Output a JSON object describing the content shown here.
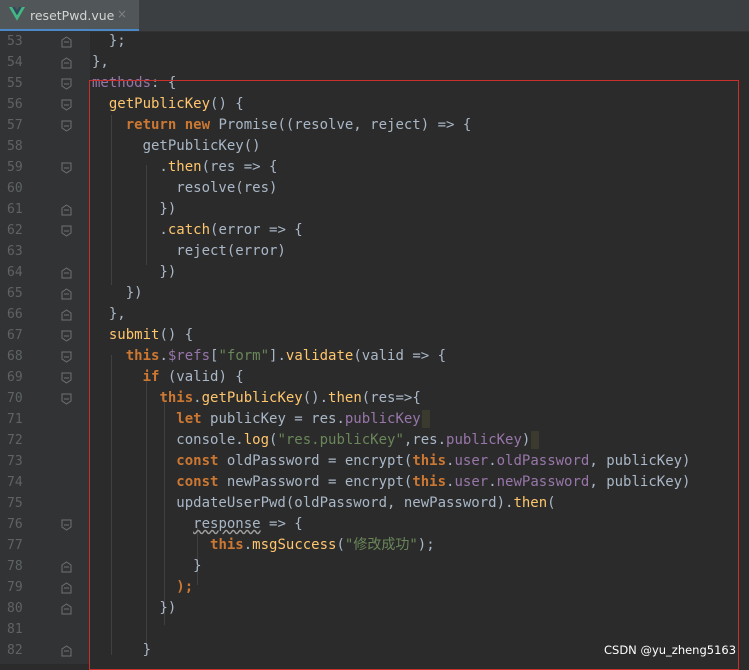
{
  "tab": {
    "filename": "resetPwd.vue",
    "close_glyph": "×",
    "icon": "vue-logo-icon"
  },
  "colors": {
    "background": "#2b2b2b",
    "gutter": "#313335",
    "keyword": "#cc7832",
    "function": "#ffc66d",
    "string": "#6a8759",
    "property": "#9876aa",
    "text": "#a9b7c6",
    "highlight_box": "#c9302c"
  },
  "lines": [
    {
      "n": "53",
      "fold": "end"
    },
    {
      "n": "54",
      "fold": "end"
    },
    {
      "n": "55",
      "fold": "start"
    },
    {
      "n": "56",
      "fold": "start"
    },
    {
      "n": "57",
      "fold": "start"
    },
    {
      "n": "58",
      "fold": ""
    },
    {
      "n": "59",
      "fold": "start"
    },
    {
      "n": "60",
      "fold": ""
    },
    {
      "n": "61",
      "fold": "end"
    },
    {
      "n": "62",
      "fold": "start"
    },
    {
      "n": "63",
      "fold": ""
    },
    {
      "n": "64",
      "fold": "end"
    },
    {
      "n": "65",
      "fold": "end"
    },
    {
      "n": "66",
      "fold": "end"
    },
    {
      "n": "67",
      "fold": "start"
    },
    {
      "n": "68",
      "fold": "start"
    },
    {
      "n": "69",
      "fold": "start"
    },
    {
      "n": "70",
      "fold": "start"
    },
    {
      "n": "71",
      "fold": ""
    },
    {
      "n": "72",
      "fold": ""
    },
    {
      "n": "73",
      "fold": ""
    },
    {
      "n": "74",
      "fold": ""
    },
    {
      "n": "75",
      "fold": ""
    },
    {
      "n": "76",
      "fold": "start"
    },
    {
      "n": "77",
      "fold": ""
    },
    {
      "n": "78",
      "fold": "end"
    },
    {
      "n": "79",
      "fold": "end"
    },
    {
      "n": "80",
      "fold": "end"
    },
    {
      "n": "81",
      "fold": ""
    },
    {
      "n": "82",
      "fold": "end"
    }
  ],
  "code": {
    "l53": {
      "a": "  };"
    },
    "l54": {
      "a": "},"
    },
    "l55": {
      "a": "methods",
      "b": ": {"
    },
    "l56": {
      "a": "  ",
      "b": "getPublicKey",
      "c": "() {"
    },
    "l57": {
      "a": "    ",
      "b": "return new ",
      "c": "Promise((resolve, reject) => {"
    },
    "l58": {
      "a": "      getPublicKey()"
    },
    "l59": {
      "a": "        .",
      "b": "then",
      "c": "(res => {"
    },
    "l60": {
      "a": "          resolve(res)"
    },
    "l61": {
      "a": "        })"
    },
    "l62": {
      "a": "        .",
      "b": "catch",
      "c": "(error => {"
    },
    "l63": {
      "a": "          reject(error)"
    },
    "l64": {
      "a": "        })"
    },
    "l65": {
      "a": "    })"
    },
    "l66": {
      "a": "  },"
    },
    "l67": {
      "a": "  ",
      "b": "submit",
      "c": "() {"
    },
    "l68": {
      "a": "    ",
      "b": "this",
      "c": ".",
      "d": "$refs",
      "e": "[",
      "f": "\"form\"",
      "g": "].",
      "h": "validate",
      "i": "(valid => {"
    },
    "l69": {
      "a": "      ",
      "b": "if ",
      "c": "(valid) {"
    },
    "l70": {
      "a": "        ",
      "b": "this",
      "c": ".",
      "d": "getPublicKey",
      "e": "().",
      "f": "then",
      "g": "(res=>{"
    },
    "l71": {
      "a": "          ",
      "b": "let ",
      "c": "publicKey = res.",
      "d": "publicKey"
    },
    "l72": {
      "a": "          console.",
      "b": "log",
      "c": "(",
      "d": "\"res.publicKey\"",
      "e": ",res.",
      "f": "publicKey",
      "g": ")"
    },
    "l73": {
      "a": "          ",
      "b": "const ",
      "c": "oldPassword = encrypt(",
      "d": "this",
      "e": ".",
      "f": "user",
      "g": ".",
      "h": "oldPassword",
      "i": ", publicKey)"
    },
    "l74": {
      "a": "          ",
      "b": "const ",
      "c": "newPassword = encrypt(",
      "d": "this",
      "e": ".",
      "f": "user",
      "g": ".",
      "h": "newPassword",
      "i": ", publicKey)"
    },
    "l75": {
      "a": "          updateUserPwd(oldPassword, newPassword).",
      "b": "then",
      "c": "("
    },
    "l76": {
      "a": "            ",
      "b": "response",
      "c": " => {"
    },
    "l77": {
      "a": "              ",
      "b": "this",
      "c": ".",
      "d": "msgSuccess",
      "e": "(",
      "f": "\"修改成功\"",
      "g": ");"
    },
    "l78": {
      "a": "            }"
    },
    "l79": {
      "a": "          ",
      "b": ");"
    },
    "l80": {
      "a": "        })"
    },
    "l81": {
      "a": ""
    },
    "l82": {
      "a": "      }"
    }
  },
  "watermark": "CSDN @yu_zheng5163"
}
